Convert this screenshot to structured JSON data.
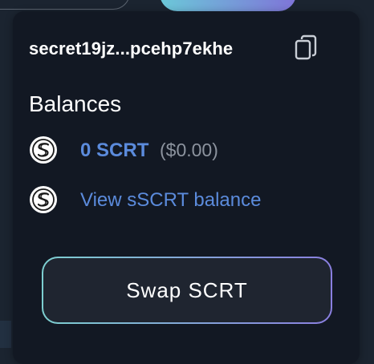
{
  "wallet": {
    "address": "secret19jz...pcehp7ekhe",
    "copy_icon": "copy-icon"
  },
  "balances": {
    "heading": "Balances",
    "scrt": {
      "icon": "secret-network-logo-icon",
      "amount": "0 SCRT",
      "usd": "($0.00)"
    },
    "sscrt": {
      "icon": "secret-network-logo-icon",
      "link": "View sSCRT balance"
    }
  },
  "actions": {
    "swap_label": "Swap SCRT"
  },
  "colors": {
    "panel_bg": "#121823",
    "link": "#5b8bdc",
    "muted": "#8c939e",
    "gradient_start": "#7dcfd0",
    "gradient_end": "#8a7fe0"
  }
}
